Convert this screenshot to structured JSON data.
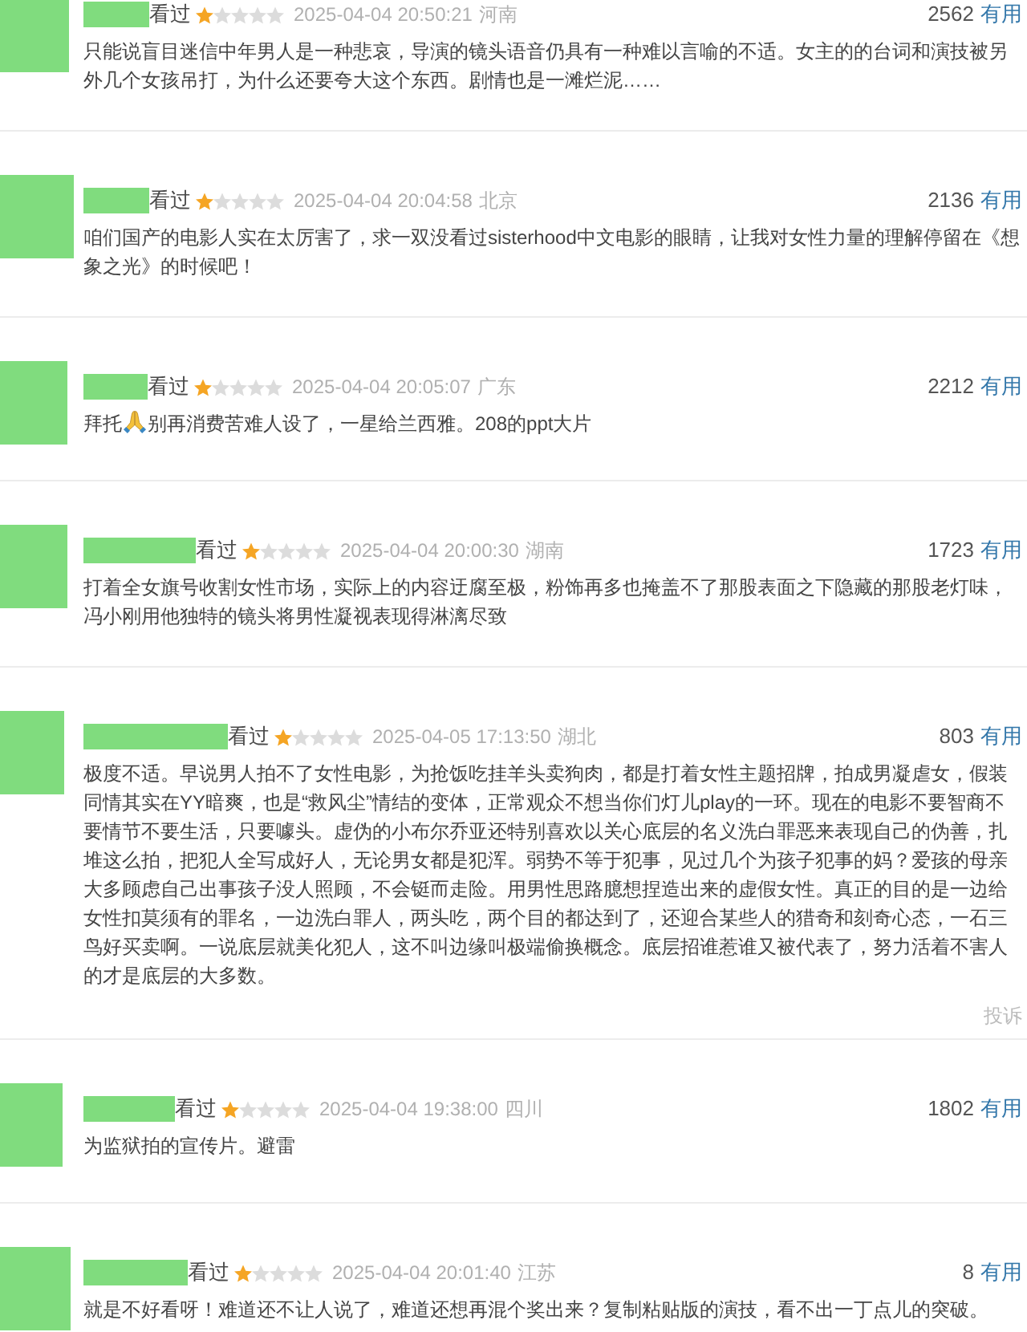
{
  "reviews": [
    {
      "status": "看过",
      "stars": 1,
      "time": "2025-04-04 20:50:21",
      "location": "河南",
      "votes": "2562",
      "vote_label": "有用",
      "comment": [
        {
          "kind": "text",
          "text": "只能说盲目迷信中年男人是一种悲哀，导演的镜头语音仍具有一种难以言喻的不适。女主的的台词和演技被另外几个女孩吊打，为什么还要夸大这个东西。剧情也是一滩烂泥……"
        }
      ]
    },
    {
      "status": "看过",
      "stars": 1,
      "time": "2025-04-04 20:04:58",
      "location": "北京",
      "votes": "2136",
      "vote_label": "有用",
      "comment": [
        {
          "kind": "text",
          "text": "咱们国产的电影人实在太厉害了，求一双没看过sisterhood中文电影的眼睛，让我对女性力量的理解停留在《想象之光》的时候吧！"
        }
      ]
    },
    {
      "status": "看过",
      "stars": 1,
      "time": "2025-04-04 20:05:07",
      "location": "广东",
      "votes": "2212",
      "vote_label": "有用",
      "comment": [
        {
          "kind": "text",
          "text": "拜托"
        },
        {
          "kind": "emoji"
        },
        {
          "kind": "text",
          "text": "别再消费苦难人设了，一星给兰西雅。208的ppt大片"
        }
      ]
    },
    {
      "status": "看过",
      "stars": 1,
      "time": "2025-04-04 20:00:30",
      "location": "湖南",
      "votes": "1723",
      "vote_label": "有用",
      "comment": [
        {
          "kind": "text",
          "text": "打着全女旗号收割女性市场，实际上的内容迂腐至极，粉饰再多也掩盖不了那股表面之下隐藏的那股老灯味，冯小刚用他独特的镜头将男性凝视表现得淋漓尽致"
        }
      ]
    },
    {
      "status": "看过",
      "stars": 1,
      "time": "2025-04-05 17:13:50",
      "location": "湖北",
      "votes": "803",
      "vote_label": "有用",
      "comment": [
        {
          "kind": "text",
          "text": "极度不适。早说男人拍不了女性电影，为抢饭吃挂羊头卖狗肉，都是打着女性主题招牌，拍成男凝虐女，假装同情其实在YY暗爽，也是“救风尘”情结的变体，正常观众不想当你们灯儿play的一环。现在的电影不要智商不要情节不要生活，只要噱头。虚伪的小布尔乔亚还特别喜欢以关心底层的名义洗白罪恶来表现自己的伪善，扎堆这么拍，把犯人全写成好人，无论男女都是犯浑。弱势不等于犯事，见过几个为孩子犯事的妈？爱孩的母亲大多顾虑自己出事孩子没人照顾，不会铤而走险。用男性思路臆想捏造出来的虚假女性。真正的目的是一边给女性扣莫须有的罪名，一边洗白罪人，两头吃，两个目的都达到了，还迎合某些人的猎奇和刻奇心态，一石三鸟好买卖啊。一说底层就美化犯人，这不叫边缘叫极端偷换概念。底层招谁惹谁又被代表了，努力活着不害人的才是底层的大多数。"
        }
      ],
      "report": "投诉"
    },
    {
      "status": "看过",
      "stars": 1,
      "time": "2025-04-04 19:38:00",
      "location": "四川",
      "votes": "1802",
      "vote_label": "有用",
      "comment": [
        {
          "kind": "text",
          "text": "为监狱拍的宣传片。避雷"
        }
      ]
    },
    {
      "status": "看过",
      "stars": 1,
      "time": "2025-04-04 20:01:40",
      "location": "江苏",
      "votes": "8",
      "vote_label": "有用",
      "comment": [
        {
          "kind": "text",
          "text": "就是不好看呀！难道还不让人说了，难道还想再混个奖出来？复制粘贴版的演技，看不出一丁点儿的突破。"
        }
      ]
    }
  ]
}
